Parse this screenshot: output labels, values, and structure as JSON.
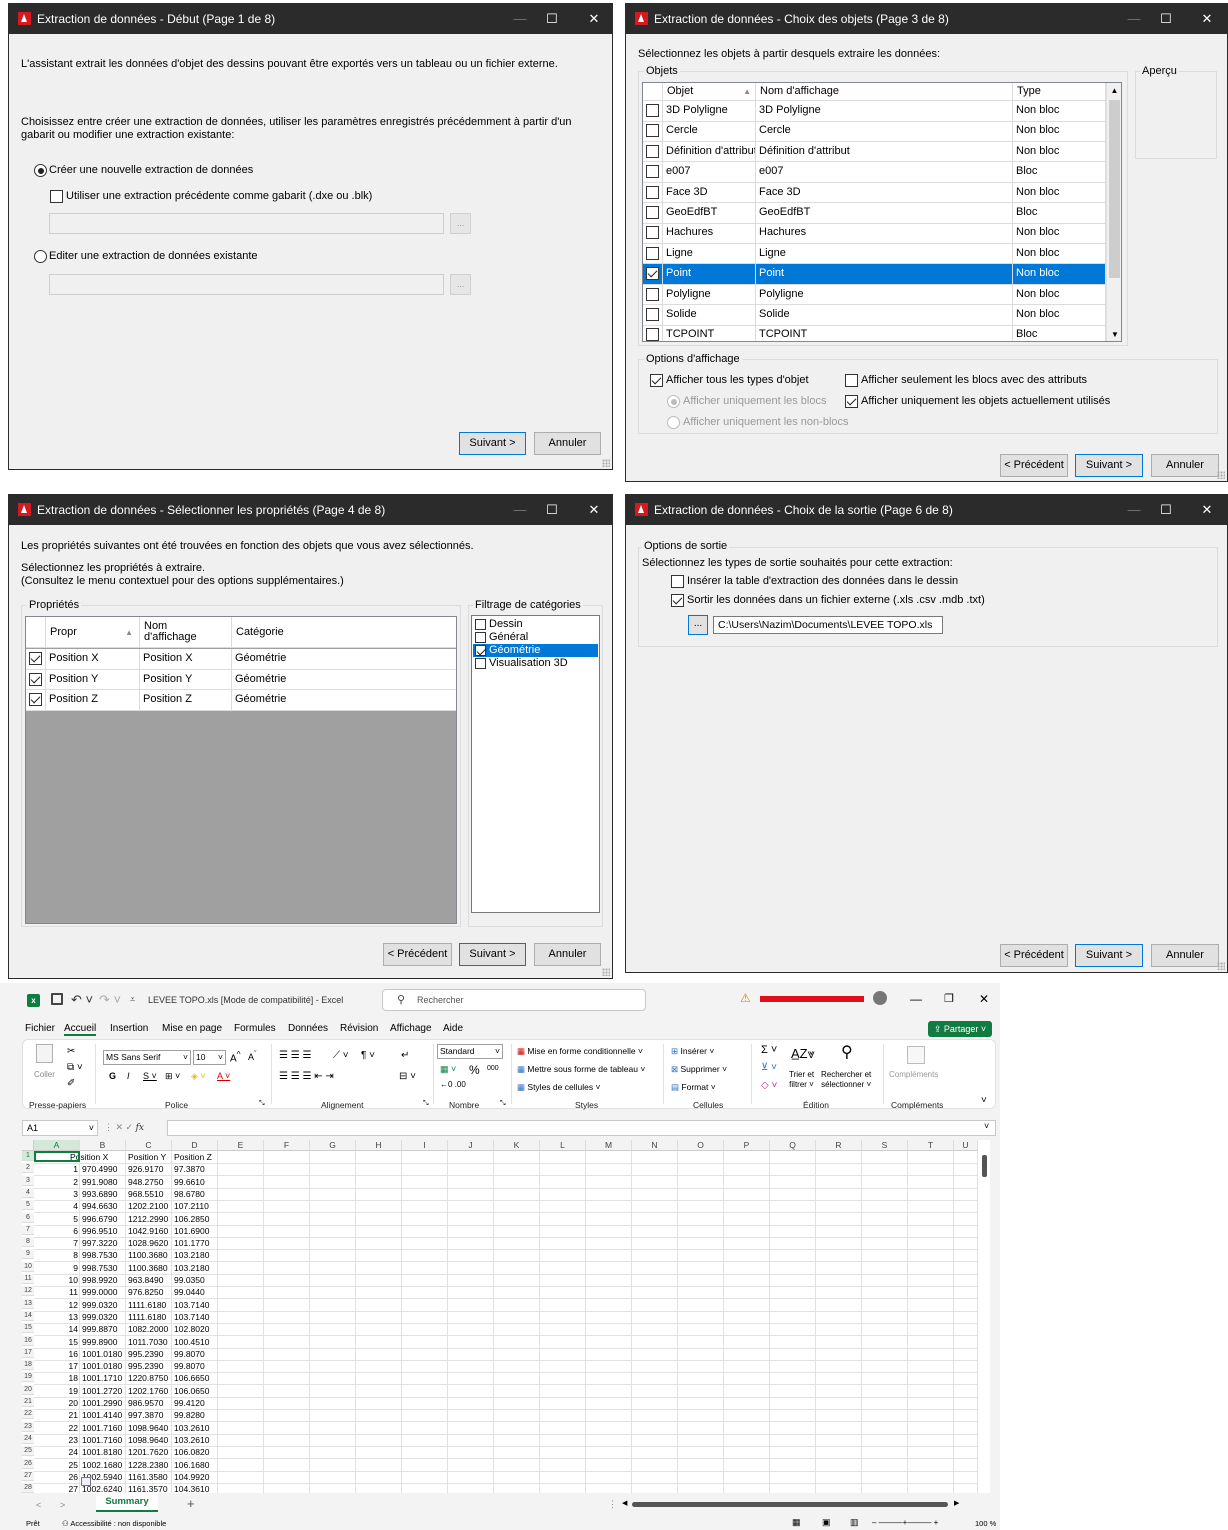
{
  "w1": {
    "title": "Extraction de données - Début (Page 1 de 8)",
    "intro": "L'assistant extrait les données d'objet des dessins pouvant être exportés vers un tableau ou un fichier externe.",
    "choose1": "Choisissez entre créer une extraction de données, utiliser les paramètres enregistrés précédemment à partir d'un",
    "choose2": "gabarit ou modifier une extraction existante:",
    "opt_new": "Créer une nouvelle extraction de données",
    "opt_template": "Utiliser une extraction précédente comme gabarit (.dxe ou .blk)",
    "opt_edit": "Editer une extraction de données existante",
    "browse": "...",
    "next": "Suivant >",
    "cancel": "Annuler"
  },
  "w3": {
    "title": "Extraction de données - Choix des objets (Page 3 de 8)",
    "prompt": "Sélectionnez les objets à partir desquels extraire les données:",
    "group_objects": "Objets",
    "preview": "Aperçu",
    "headers": [
      "Objet",
      "Nom d'affichage",
      "Type"
    ],
    "rows": [
      {
        "objet": "3D Polyligne",
        "nom": "3D Polyligne",
        "type": "Non bloc",
        "checked": false
      },
      {
        "objet": "Cercle",
        "nom": "Cercle",
        "type": "Non bloc",
        "checked": false
      },
      {
        "objet": "Définition d'attribut",
        "nom": "Définition d'attribut",
        "type": "Non bloc",
        "checked": false
      },
      {
        "objet": "e007",
        "nom": "e007",
        "type": "Bloc",
        "checked": false
      },
      {
        "objet": "Face 3D",
        "nom": "Face 3D",
        "type": "Non bloc",
        "checked": false
      },
      {
        "objet": "GeoEdfBT",
        "nom": "GeoEdfBT",
        "type": "Bloc",
        "checked": false
      },
      {
        "objet": "Hachures",
        "nom": "Hachures",
        "type": "Non bloc",
        "checked": false
      },
      {
        "objet": "Ligne",
        "nom": "Ligne",
        "type": "Non bloc",
        "checked": false
      },
      {
        "objet": "Point",
        "nom": "Point",
        "type": "Non bloc",
        "checked": true
      },
      {
        "objet": "Polyligne",
        "nom": "Polyligne",
        "type": "Non bloc",
        "checked": false
      },
      {
        "objet": "Solide",
        "nom": "Solide",
        "type": "Non bloc",
        "checked": false
      },
      {
        "objet": "TCPOINT",
        "nom": "TCPOINT",
        "type": "Bloc",
        "checked": false
      }
    ],
    "display_options": "Options d'affichage",
    "show_all": "Afficher tous les types d'objet",
    "only_blocks_attr": "Afficher seulement les  blocs avec des attributs",
    "only_blocks": "Afficher uniquement les blocs",
    "only_used": "Afficher uniquement les objets actuellement utilisés",
    "only_nonblocks": "Afficher uniquement les non-blocs",
    "prev": "< Précédent",
    "next": "Suivant >",
    "cancel": "Annuler"
  },
  "w4": {
    "title": "Extraction de données - Sélectionner les propriétés (Page 4 de 8)",
    "found": "Les propriétés suivantes ont été trouvées en fonction des objets que vous avez sélectionnés.",
    "select": "Sélectionnez les propriétés à extraire.",
    "ctx": "(Consultez le menu contextuel pour des options supplémentaires.)",
    "group_props": "Propriétés",
    "headers": {
      "propr": "Propr",
      "nom1": "Nom",
      "nom2": "d'affichage",
      "cat": "Catégorie"
    },
    "rows": [
      {
        "propr": "Position X",
        "nom": "Position X",
        "cat": "Géométrie"
      },
      {
        "propr": "Position Y",
        "nom": "Position Y",
        "cat": "Géométrie"
      },
      {
        "propr": "Position Z",
        "nom": "Position Z",
        "cat": "Géométrie"
      }
    ],
    "group_filter": "Filtrage de catégories",
    "filters": [
      {
        "label": "Dessin",
        "checked": false
      },
      {
        "label": "Général",
        "checked": false
      },
      {
        "label": "Géométrie",
        "checked": true
      },
      {
        "label": "Visualisation 3D",
        "checked": false
      }
    ],
    "prev": "< Précédent",
    "next": "Suivant >",
    "cancel": "Annuler"
  },
  "w6": {
    "title": "Extraction de données - Choix de la sortie (Page 6 de 8)",
    "group_output": "Options de sortie",
    "prompt": "Sélectionnez les types de sortie souhaités pour cette extraction:",
    "insert_table": "Insérer la table d'extraction des données dans le dessin",
    "external_file": "Sortir les données dans un fichier externe (.xls .csv .mdb .txt)",
    "browse": "...",
    "path": "C:\\Users\\Nazim\\Documents\\LEVEE TOPO.xls",
    "prev": "< Précédent",
    "next": "Suivant >",
    "cancel": "Annuler"
  },
  "excel": {
    "title": "LEVEE TOPO.xls  [Mode de compatibilité]  -  Excel",
    "search_placeholder": "Rechercher",
    "share": "Partager",
    "menu": [
      "Fichier",
      "Accueil",
      "Insertion",
      "Mise en page",
      "Formules",
      "Données",
      "Révision",
      "Affichage",
      "Aide"
    ],
    "ribbon": {
      "paste": "Coller",
      "font_name": "MS Sans Serif",
      "font_size": "10",
      "number_format": "Standard",
      "cond_format": "Mise en forme conditionnelle",
      "table_format": "Mettre sous forme de tableau",
      "cell_styles": "Styles de cellules",
      "insert": "Insérer",
      "delete": "Supprimer",
      "format": "Format",
      "sort1": "Trier et",
      "sort2": "filtrer",
      "find1": "Rechercher et",
      "find2": "sélectionner",
      "addins": "Compléments",
      "groups": [
        "Presse-papiers",
        "Police",
        "Alignement",
        "Nombre",
        "Styles",
        "Cellules",
        "Édition",
        "Compléments"
      ]
    },
    "name_box": "A1",
    "fx": "fx",
    "columns": [
      "A",
      "B",
      "C",
      "D",
      "E",
      "F",
      "G",
      "H",
      "I",
      "J",
      "K",
      "L",
      "M",
      "N",
      "O",
      "P",
      "Q",
      "R",
      "S",
      "T",
      "U"
    ],
    "header_row": [
      "",
      "Position X",
      "Position Y",
      "Position Z"
    ],
    "rows": [
      [
        "1",
        "970.4990",
        "926.9170",
        "97.3870"
      ],
      [
        "2",
        "991.9080",
        "948.2750",
        "99.6610"
      ],
      [
        "3",
        "993.6890",
        "968.5510",
        "98.6780"
      ],
      [
        "4",
        "994.6630",
        "1202.2100",
        "107.2110"
      ],
      [
        "5",
        "996.6790",
        "1212.2990",
        "106.2850"
      ],
      [
        "6",
        "996.9510",
        "1042.9160",
        "101.6900"
      ],
      [
        "7",
        "997.3220",
        "1028.9620",
        "101.1770"
      ],
      [
        "8",
        "998.7530",
        "1100.3680",
        "103.2180"
      ],
      [
        "9",
        "998.7530",
        "1100.3680",
        "103.2180"
      ],
      [
        "10",
        "998.9920",
        "963.8490",
        "99.0350"
      ],
      [
        "11",
        "999.0000",
        "976.8250",
        "99.0440"
      ],
      [
        "12",
        "999.0320",
        "1111.6180",
        "103.7140"
      ],
      [
        "13",
        "999.0320",
        "1111.6180",
        "103.7140"
      ],
      [
        "14",
        "999.8870",
        "1082.2000",
        "102.8020"
      ],
      [
        "15",
        "999.8900",
        "1011.7030",
        "100.4510"
      ],
      [
        "16",
        "1001.0180",
        "995.2390",
        "99.8070"
      ],
      [
        "17",
        "1001.0180",
        "995.2390",
        "99.8070"
      ],
      [
        "18",
        "1001.1710",
        "1220.8750",
        "106.6650"
      ],
      [
        "19",
        "1001.2720",
        "1202.1760",
        "106.0650"
      ],
      [
        "20",
        "1001.2990",
        "986.9570",
        "99.4120"
      ],
      [
        "21",
        "1001.4140",
        "997.3870",
        "99.8280"
      ],
      [
        "22",
        "1001.7160",
        "1098.9640",
        "103.2610"
      ],
      [
        "23",
        "1001.7160",
        "1098.9640",
        "103.2610"
      ],
      [
        "24",
        "1001.8180",
        "1201.7620",
        "106.0820"
      ],
      [
        "25",
        "1002.1680",
        "1228.2380",
        "106.1680"
      ],
      [
        "26",
        "1002.5940",
        "1161.3580",
        "104.9920"
      ],
      [
        "27",
        "1002.6240",
        "1161.3570",
        "104.3610"
      ]
    ],
    "sheet_tab": "Summary",
    "status_ready": "Prêt",
    "status_access": "Accessibilité : non disponible",
    "zoom": "100 %"
  }
}
